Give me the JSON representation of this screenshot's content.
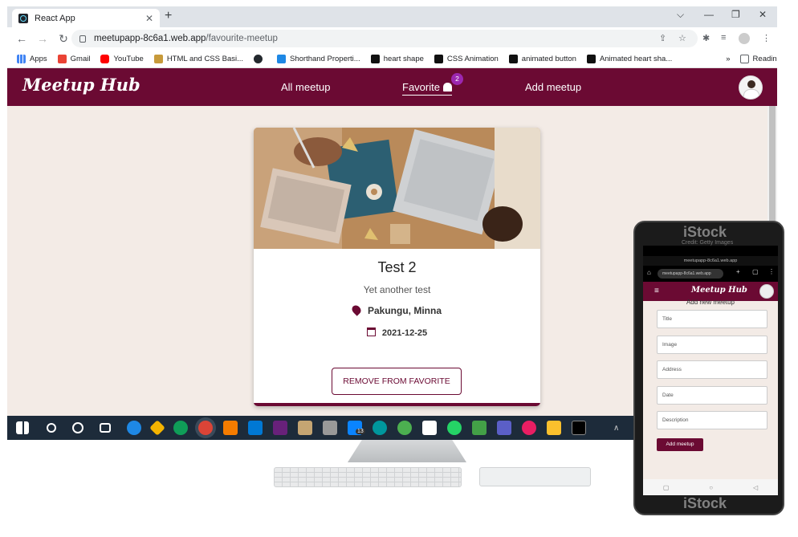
{
  "browser": {
    "tab_title": "React App",
    "new_tab": "+",
    "close_tab": "✕",
    "window_controls": [
      "⌵",
      "—",
      "❐",
      "✕"
    ],
    "url_domain": "meetupapp-8c6a1.web.app",
    "url_path": "/favourite-meetup",
    "bookmarks": [
      "Apps",
      "Gmail",
      "YouTube",
      "HTML and CSS Basi...",
      "Shorthand Properti...",
      "heart shape",
      "CSS Animation",
      "animated button",
      "Animated heart sha..."
    ],
    "bookmark_more": "»",
    "reading_list": "Reading list"
  },
  "app": {
    "logo": "Meetup Hub",
    "nav": {
      "all_meetup": "All meetup",
      "favorite": "Favorite",
      "favorite_count": "2",
      "add_meetup": "Add meetup"
    }
  },
  "meetup_card": {
    "title": "Test 2",
    "description": "Yet another test",
    "address": "Pakungu, Minna",
    "date": "2021-12-25",
    "remove_button": "REMOVE FROM FAVORITE"
  },
  "taskbar": {
    "mail_badge": "13"
  },
  "phone": {
    "url": "meetupapp-8c6a1.web.app",
    "logo": "Meetup Hub",
    "heading": "Add new meetup",
    "fields": [
      "Title",
      "Image",
      "Address",
      "Date",
      "Description"
    ],
    "submit": "Add meetup"
  },
  "watermark": {
    "brand": "iStock",
    "credit": "Credit: Getty Images"
  },
  "colors": {
    "brand": "#6b0a33",
    "page_bg": "#f3ebe6",
    "badge": "#9c27b0"
  }
}
